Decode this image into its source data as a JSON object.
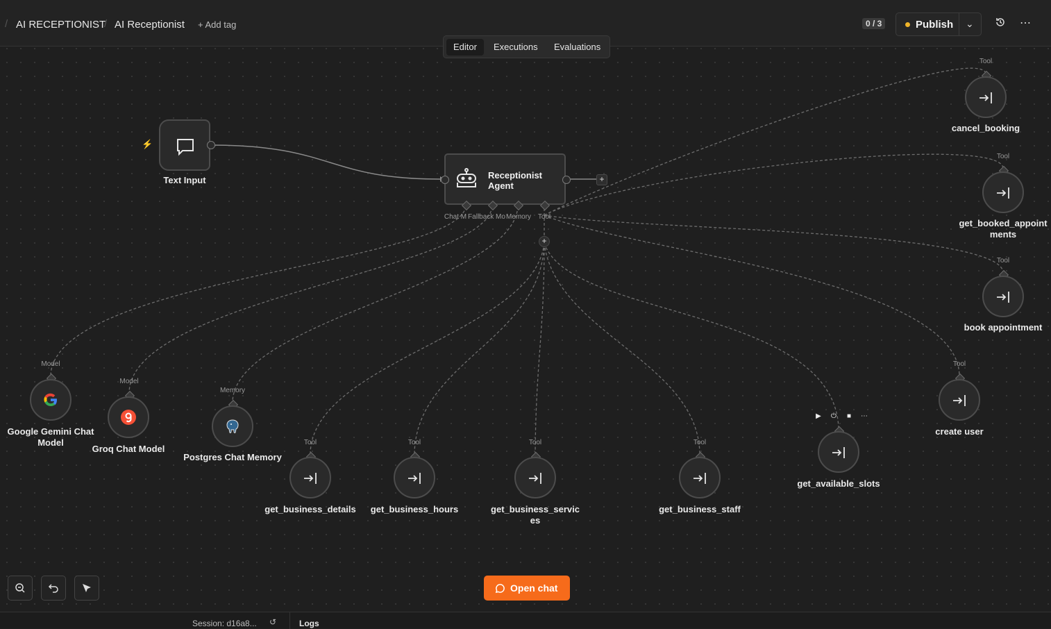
{
  "breadcrumb": {
    "project": "AI RECEPTIONIST",
    "workflow": "AI Receptionist",
    "add_tag": "+ Add tag"
  },
  "header": {
    "counter": "0 / 3",
    "publish_label": "Publish"
  },
  "tabs": {
    "editor": "Editor",
    "executions": "Executions",
    "evaluations": "Evaluations"
  },
  "nodes": {
    "text_input": "Text Input",
    "agent": "Receptionist Agent",
    "gemini": "Google Gemini Chat Model",
    "groq": "Groq Chat Model",
    "postgres": "Postgres Chat Memory",
    "get_business_details": "get_business_details",
    "get_business_hours": "get_business_hours",
    "get_business_services": "get_business_servic es",
    "get_business_staff": "get_business_staff",
    "get_available_slots": "get_available_slots",
    "create_user": "create user",
    "book_appointment": "book appointment",
    "get_booked_appointments": "get_booked_appoint ments",
    "cancel_booking": "cancel_booking"
  },
  "ports": {
    "chat_model": "Chat M",
    "fallback": "Fallback Mo",
    "memory": "Memory",
    "tool": "Tool",
    "model": "Model"
  },
  "open_chat": "Open chat",
  "footer": {
    "session": "Session: d16a8...",
    "logs": "Logs"
  },
  "colors": {
    "accent": "#f66b1b",
    "publish_dot": "#f0b429"
  }
}
